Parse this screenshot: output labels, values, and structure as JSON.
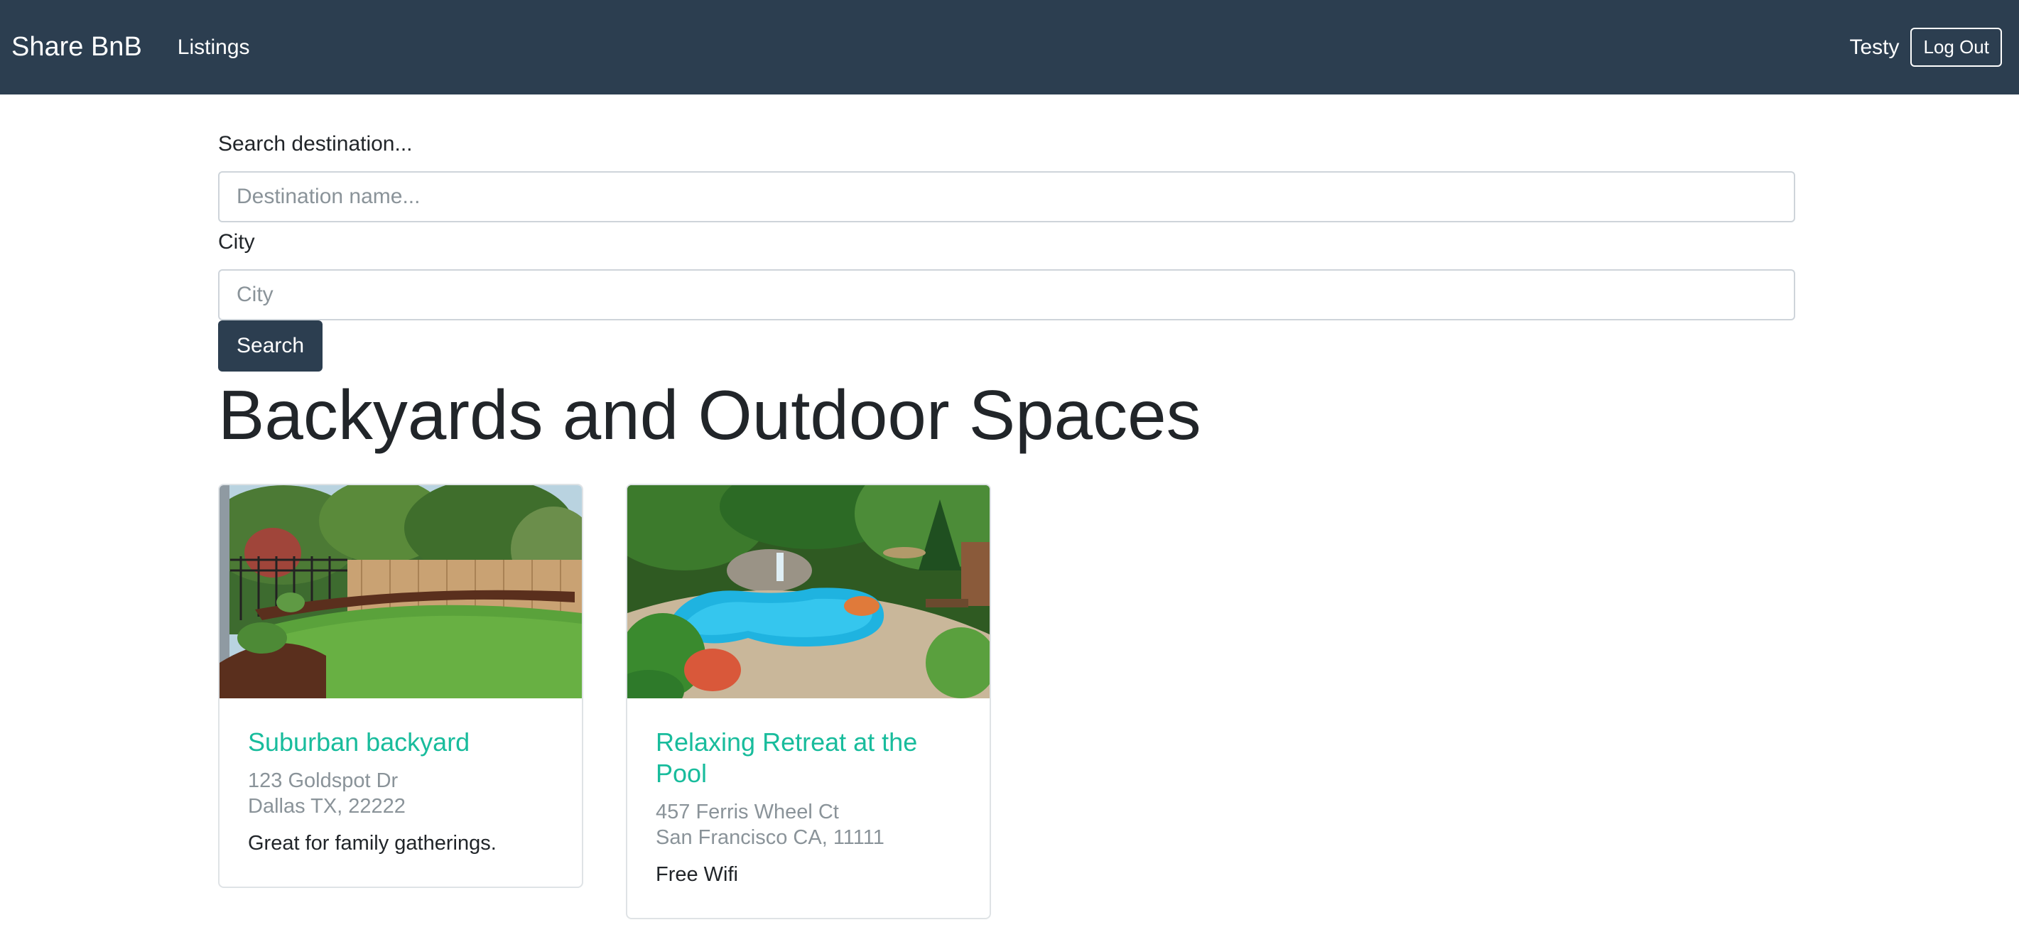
{
  "nav": {
    "brand": "Share BnB",
    "listings_label": "Listings",
    "username": "Testy",
    "logout_label": "Log Out"
  },
  "search": {
    "destination_label": "Search destination...",
    "destination_placeholder": "Destination name...",
    "city_label": "City",
    "city_placeholder": "City",
    "button_label": "Search"
  },
  "section": {
    "title": "Backyards and Outdoor Spaces"
  },
  "listings": [
    {
      "title": "Suburban backyard",
      "address_line1": "123 Goldspot Dr",
      "address_line2": "Dallas TX, 22222",
      "description": "Great for family gatherings."
    },
    {
      "title": "Relaxing Retreat at the Pool",
      "address_line1": "457 Ferris Wheel Ct",
      "address_line2": "San Francisco CA, 11111",
      "description": "Free Wifi"
    }
  ],
  "colors": {
    "navbar": "#2c3e50",
    "accent": "#18bc9c",
    "muted": "#8a9399"
  }
}
